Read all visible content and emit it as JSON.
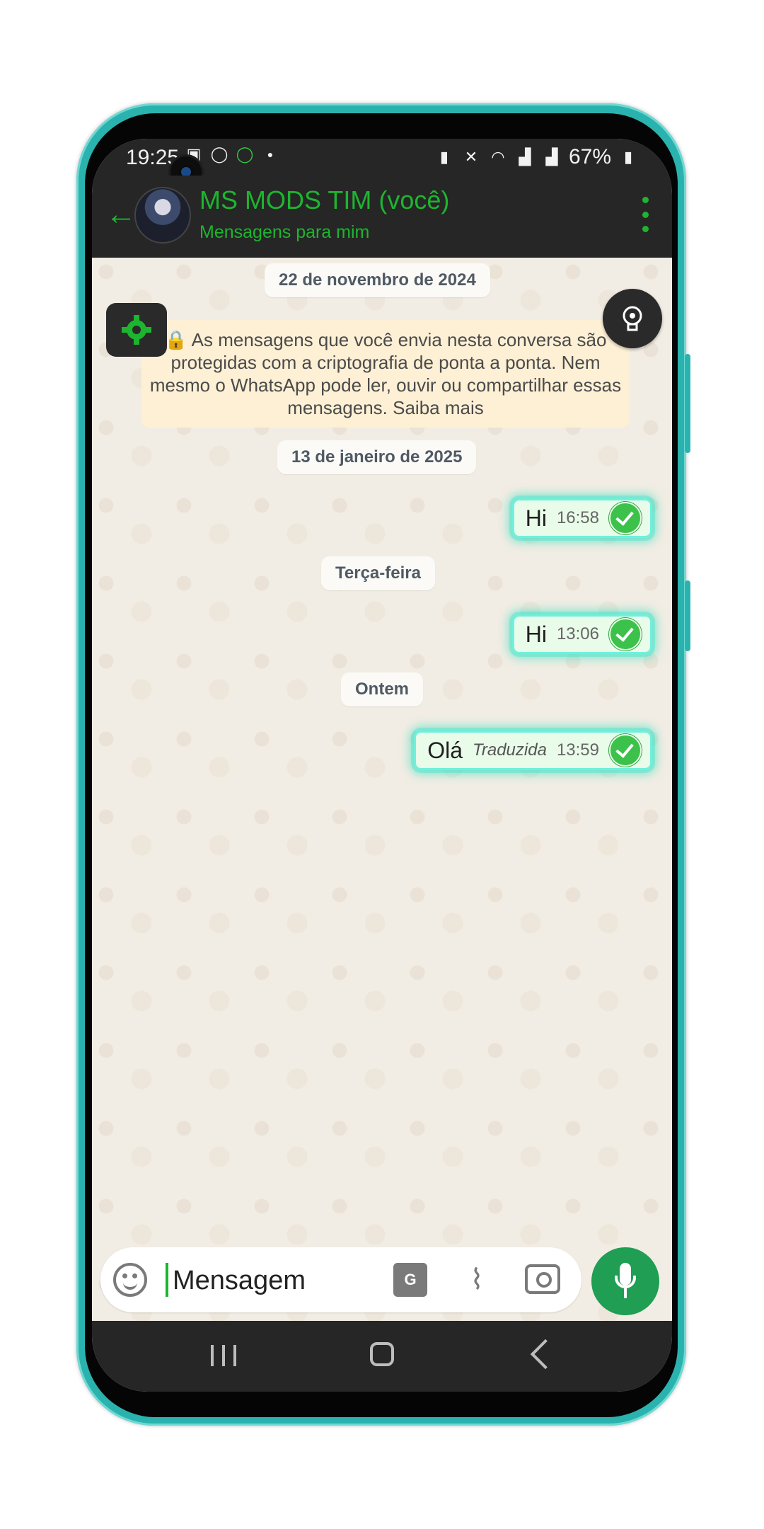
{
  "status_bar": {
    "time": "19:25",
    "battery": "67%",
    "icons": [
      "image-icon",
      "whatsapp-icon",
      "whatsapp-business-icon",
      "dot-icon",
      "nfc-icon",
      "mute-icon",
      "wifi-icon",
      "signal-icon",
      "signal-icon",
      "battery-icon"
    ]
  },
  "header": {
    "name": "MS MODS TIM (você)",
    "subtitle": "Mensagens para mim",
    "accent": "#1db52f"
  },
  "chat": {
    "date1": "22 de novembro de 2024",
    "encryption_notice": "🔒 As mensagens que você envia nesta conversa são protegidas com a criptografia de ponta a ponta. Nem mesmo o WhatsApp pode ler, ouvir ou compartilhar essas mensagens. Saiba mais",
    "date2": "13 de janeiro de 2025",
    "date3": "Terça-feira",
    "date4": "Ontem",
    "messages": [
      {
        "text": "Hi",
        "time": "16:58"
      },
      {
        "text": "Hi",
        "time": "13:06"
      },
      {
        "text": "Olá",
        "label": "Traduzida",
        "time": "13:59"
      }
    ]
  },
  "input": {
    "placeholder": "Mensagem"
  },
  "colors": {
    "bubble_glow": "#3ce6c8",
    "mic_button": "#1f9e54",
    "frame": "#2ab3ae"
  }
}
